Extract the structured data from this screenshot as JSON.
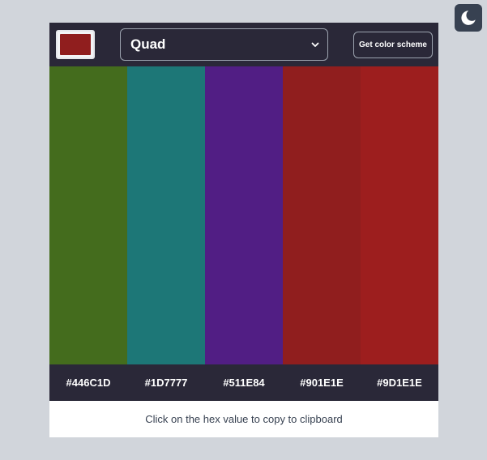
{
  "theme_toggle": {
    "icon": "moon-icon"
  },
  "toolbar": {
    "seed_color": "#901E1E",
    "mode_select": {
      "selected": "Quad",
      "icon": "chevron-down-icon"
    },
    "get_scheme_label": "Get color scheme"
  },
  "palette": {
    "colors": [
      "#446C1D",
      "#1D7777",
      "#511E84",
      "#901E1E",
      "#9D1E1E"
    ],
    "hex_values": [
      "#446C1D",
      "#1D7777",
      "#511E84",
      "#901E1E",
      "#9D1E1E"
    ]
  },
  "footer": {
    "note": "Click on the hex value to copy to clipboard"
  }
}
